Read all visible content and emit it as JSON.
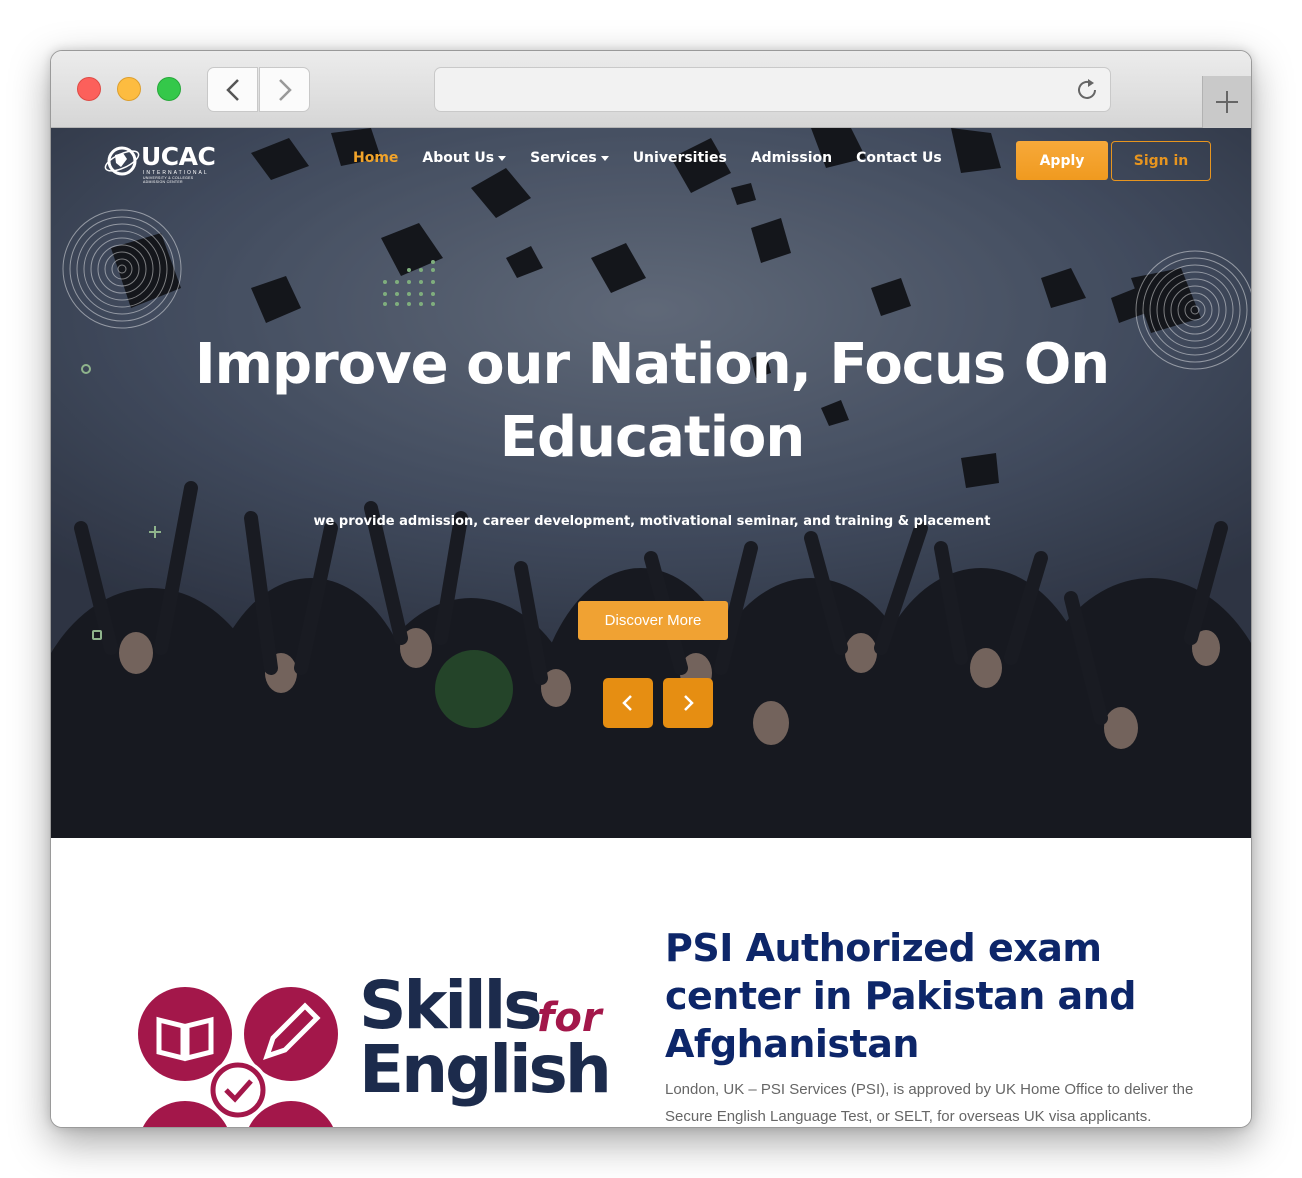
{
  "nav": {
    "logo_text": "UCAC",
    "logo_subtitle": "INTERNATIONAL",
    "logo_tagline": "UNIVERSITY & COLLEGES ADMISSION CENTER",
    "items": [
      {
        "label": "Home"
      },
      {
        "label": "About Us"
      },
      {
        "label": "Services"
      },
      {
        "label": "Universities"
      },
      {
        "label": "Admission"
      },
      {
        "label": "Contact Us"
      }
    ],
    "apply_label": "Apply",
    "signin_label": "Sign in"
  },
  "hero": {
    "title": "Improve our Nation, Focus On Education",
    "subtitle": "we provide admission, career development, motivational seminar, and training & placement",
    "cta_label": "Discover More"
  },
  "section": {
    "title": "PSI Authorized exam center in Pakistan and Afghanistan",
    "text": "London, UK – PSI Services (PSI), is approved by UK Home Office to deliver the Secure English Language Test, or SELT, for overseas UK visa applicants.",
    "logo_line1": "Skills",
    "logo_for": "for",
    "logo_line2": "English"
  },
  "icons": {
    "back": "chevron-left-icon",
    "forward": "chevron-right-icon",
    "reload": "reload-icon",
    "new_tab": "plus-icon",
    "carousel_prev": "chevron-left-icon",
    "carousel_next": "chevron-right-icon"
  },
  "colors": {
    "accent": "#f09a1f",
    "heading": "#0d2669",
    "brand_maroon": "#a3174a",
    "brand_navy": "#1c2b4c"
  }
}
